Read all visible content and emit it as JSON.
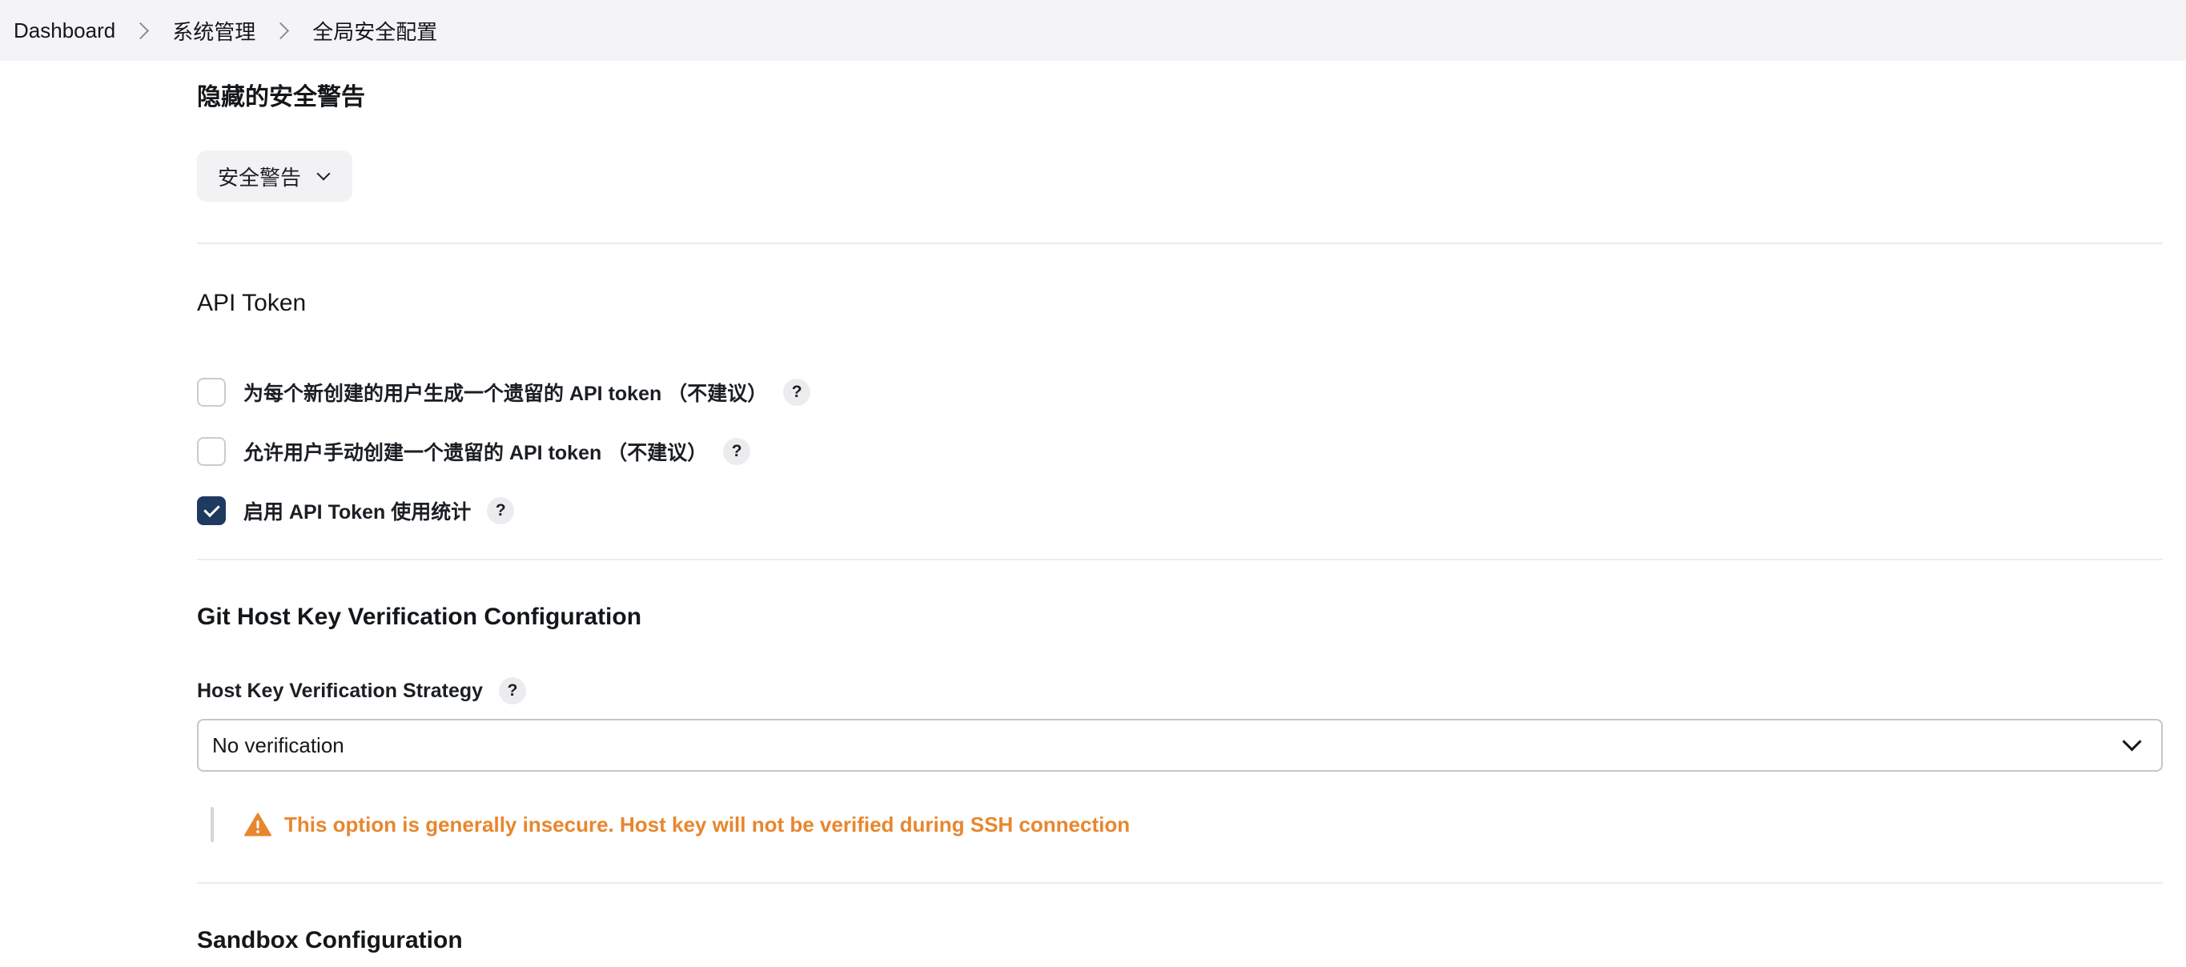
{
  "breadcrumb": {
    "items": [
      "Dashboard",
      "系统管理",
      "全局安全配置"
    ]
  },
  "hidden_security_warnings": {
    "title": "隐藏的安全警告",
    "dropdown_label": "安全警告"
  },
  "api_token": {
    "title": "API Token",
    "options": [
      {
        "label": "为每个新创建的用户生成一个遗留的 API token （不建议）",
        "checked": false
      },
      {
        "label": "允许用户手动创建一个遗留的 API token （不建议）",
        "checked": false
      },
      {
        "label": "启用 API Token 使用统计",
        "checked": true
      }
    ],
    "help_glyph": "?"
  },
  "git_host_key": {
    "title": "Git Host Key Verification Configuration",
    "field_label": "Host Key Verification Strategy",
    "selected_value": "No verification",
    "warning_text": "This option is generally insecure. Host key will not be verified during SSH connection"
  },
  "sandbox": {
    "title": "Sandbox Configuration"
  },
  "icons": {
    "breadcrumb_separator": "chevron-right-icon",
    "dropdown": "chevron-down-icon",
    "help": "help-icon",
    "warning": "warning-triangle-icon",
    "check": "check-icon"
  },
  "colors": {
    "checkbox_checked": "#1e3a5f",
    "warning": "#e8862d",
    "breadcrumb_bg": "#f4f4f6"
  }
}
